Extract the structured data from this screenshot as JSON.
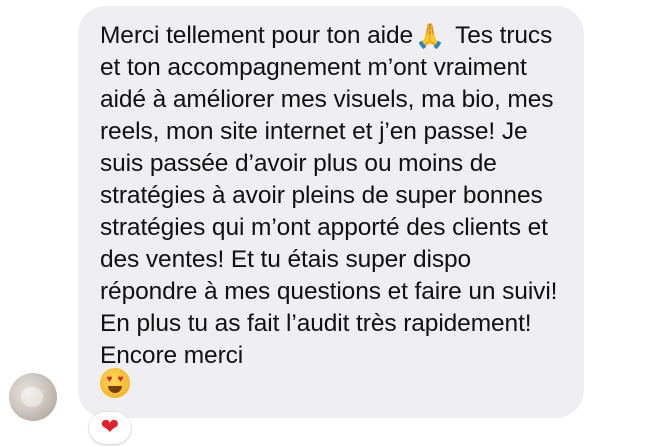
{
  "message": {
    "text_before_emoji": "Merci tellement pour ton aide",
    "inline_emoji": "🙏",
    "text_after_emoji": " Tes trucs et ton accompagnement m’ont vraiment aidé à améliorer mes visuels, ma bio, mes reels, mon site internet et j’en passe! Je suis passée d’avoir plus ou moins de stratégies à avoir pleins de super bonnes stratégies qui m’ont apporté des clients et des ventes! Et tu étais super dispo répondre à mes questions et faire un suivi! En plus tu as fait l’audit très rapidement! Encore merci",
    "closing_emoji": "heart-eyes-emoji"
  },
  "reaction": {
    "emoji": "❤",
    "icon": "red-heart-icon"
  },
  "avatar": {
    "icon": "profile-avatar"
  },
  "colors": {
    "bubble_background": "#efeff1",
    "text": "#111111",
    "reaction_heart": "#e3202a"
  }
}
